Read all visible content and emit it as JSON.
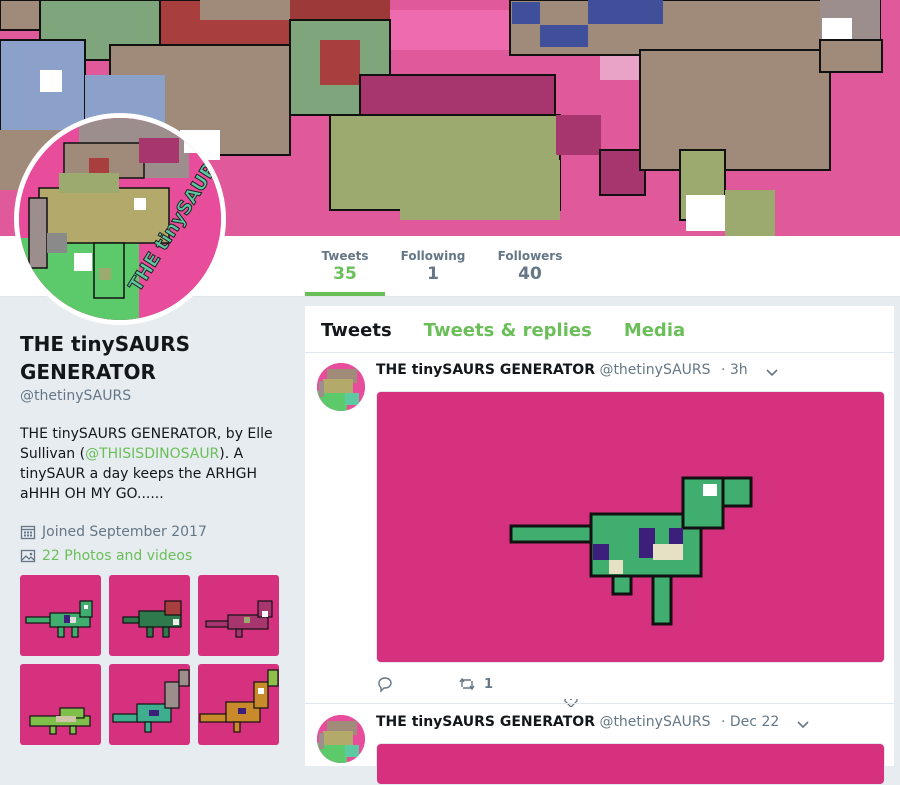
{
  "profile": {
    "name": "THE tinySAURS GENERATOR",
    "handle": "@thetinySAURS",
    "bio_prefix": "THE tinySAURS GENERATOR, by Elle Sullivan (",
    "bio_link": "@THISISDINOSAUR",
    "bio_suffix": "). A tinySAUR a day keeps the ARHGH aHHH OH MY GO......",
    "joined": "Joined September 2017",
    "photos_label": "22 Photos and videos",
    "avatar_text": "THE tinySAUR GENERATOR"
  },
  "stats": [
    {
      "label": "Tweets",
      "value": "35",
      "active": true
    },
    {
      "label": "Following",
      "value": "1",
      "active": false
    },
    {
      "label": "Followers",
      "value": "40",
      "active": false
    }
  ],
  "tabs": [
    {
      "label": "Tweets",
      "active": true
    },
    {
      "label": "Tweets & replies",
      "active": false
    },
    {
      "label": "Media",
      "active": false
    }
  ],
  "tweets": [
    {
      "author": "THE tinySAURS GENERATOR",
      "handle": "@thetinySAURS",
      "time": "· 3h",
      "retweets": "1"
    },
    {
      "author": "THE tinySAURS GENERATOR",
      "handle": "@thetinySAURS",
      "time": "· Dec 22"
    }
  ],
  "colors": {
    "accent": "#6bbf59",
    "media_bg": "#d6317f",
    "banner_bg": "#e05a9b"
  },
  "icons": [
    "calendar-icon",
    "image-icon",
    "reply-icon",
    "retweet-icon",
    "like-icon",
    "chevron-down-icon"
  ]
}
